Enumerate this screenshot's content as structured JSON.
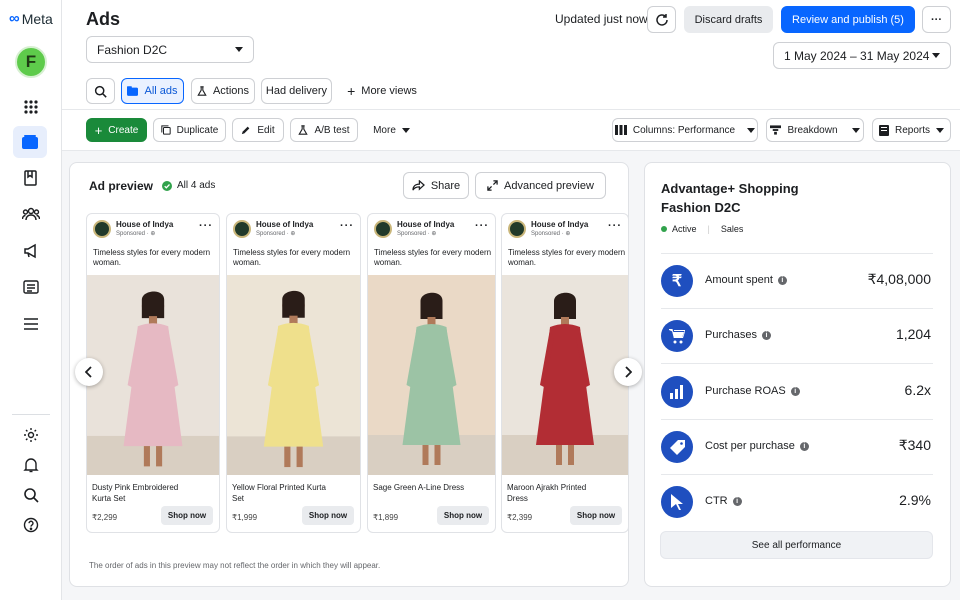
{
  "brand": {
    "logo_text": "Meta",
    "avatar_letter": "F"
  },
  "header": {
    "title": "Ads",
    "status": "Updated just now",
    "discard_label": "Discard drafts",
    "publish_label": "Review and publish (5)",
    "more_label": "···"
  },
  "account_select": {
    "value": "Fashion D2C"
  },
  "date_range": {
    "value": "1 May 2024 – 31 May 2024"
  },
  "view_tabs": {
    "all_ads": "All ads",
    "actions": "Actions",
    "had_delivery": "Had delivery",
    "more_views": "More views"
  },
  "toolbar": {
    "create": "Create",
    "duplicate": "Duplicate",
    "edit": "Edit",
    "ab_test": "A/B test",
    "more": "More",
    "columns": "Columns: Performance",
    "breakdown": "Breakdown",
    "reports": "Reports"
  },
  "preview": {
    "title": "Ad preview",
    "filter": "All 4 ads",
    "share": "Share",
    "advanced": "Advanced preview",
    "footer_note": "The order of ads in this preview may not reflect the order in which they will appear.",
    "ads": [
      {
        "brand": "House of Indya",
        "sponsored": "Sponsored · ⊕",
        "caption": "Timeless styles for every modern woman.",
        "name": "Dusty Pink Embroidered Kurta Set",
        "price": "₹2,299",
        "cta": "Shop now",
        "dress": "#e6b9c3",
        "bg": "#e9e2da"
      },
      {
        "brand": "House of Indya",
        "sponsored": "Sponsored · ⊕",
        "caption": "Timeless styles for every modern woman.",
        "name": "Yellow Floral Printed Kurta Set",
        "price": "₹1,999",
        "cta": "Shop now",
        "dress": "#efe08c",
        "bg": "#ece4d6"
      },
      {
        "brand": "House of Indya",
        "sponsored": "Sponsored · ⊕",
        "caption": "Timeless styles for every modern woman.",
        "name": "Sage Green A-Line Dress",
        "price": "₹1,899",
        "cta": "Shop now",
        "dress": "#9cc3a5",
        "bg": "#ead9c6"
      },
      {
        "brand": "House of Indya",
        "sponsored": "Sponsored · ⊕",
        "caption": "Timeless styles for every modern woman.",
        "name": "Maroon Ajrakh Printed Dress",
        "price": "₹2,399",
        "cta": "Shop now",
        "dress": "#b22d34",
        "bg": "#eae4dc"
      }
    ]
  },
  "summary": {
    "campaign": "Advantage+ Shopping Fashion D2C",
    "status": "Active",
    "objective": "Sales",
    "status_color": "#31a24c",
    "metrics": [
      {
        "label": "Amount spent",
        "value": "₹4,08,000",
        "icon": "rupee-icon"
      },
      {
        "label": "Purchases",
        "value": "1,204",
        "icon": "cart-icon"
      },
      {
        "label": "Purchase ROAS",
        "value": "6.2x",
        "icon": "bar-chart-icon"
      },
      {
        "label": "Cost per purchase",
        "value": "₹340",
        "icon": "tag-icon"
      },
      {
        "label": "CTR",
        "value": "2.9%",
        "icon": "cursor-icon"
      }
    ],
    "see_all": "See all performance"
  },
  "colors": {
    "accent": "#0866ff",
    "create": "#1a8a3a",
    "metric_icon": "#1f4fbf"
  }
}
